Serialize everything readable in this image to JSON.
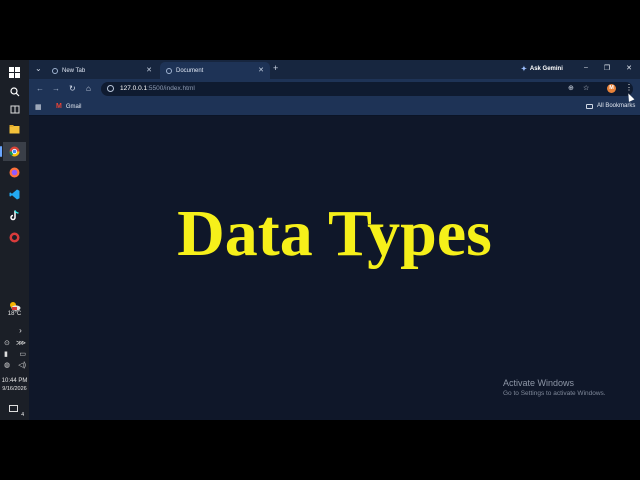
{
  "taskbar": {
    "weather_temp": "18°C",
    "clock_time": "10:44 PM",
    "clock_date": "9/16/2026",
    "notification_count": "4",
    "icons": [
      "windows-start-icon",
      "search-icon",
      "task-view-icon",
      "file-explorer-icon",
      "chrome-icon",
      "firefox-icon",
      "vscode-icon",
      "tiktok-icon",
      "app-icon"
    ]
  },
  "tabs": [
    {
      "label": "New Tab",
      "icon": "chrome-icon"
    },
    {
      "label": "Document",
      "icon": "globe-icon"
    }
  ],
  "ask_gemini_label": "Ask Gemini",
  "address_bar": {
    "host": "127.0.0.1",
    "path": ":5500/index.html"
  },
  "profile_initial": "M",
  "bookmarks": {
    "gmail_label": "Gmail",
    "all_bookmarks_label": "All Bookmarks"
  },
  "page": {
    "heading": "Data Types",
    "heading_color": "#f6f01a",
    "background": "#0f1729"
  },
  "watermark": {
    "title": "Activate Windows",
    "subtitle": "Go to Settings to activate Windows."
  }
}
